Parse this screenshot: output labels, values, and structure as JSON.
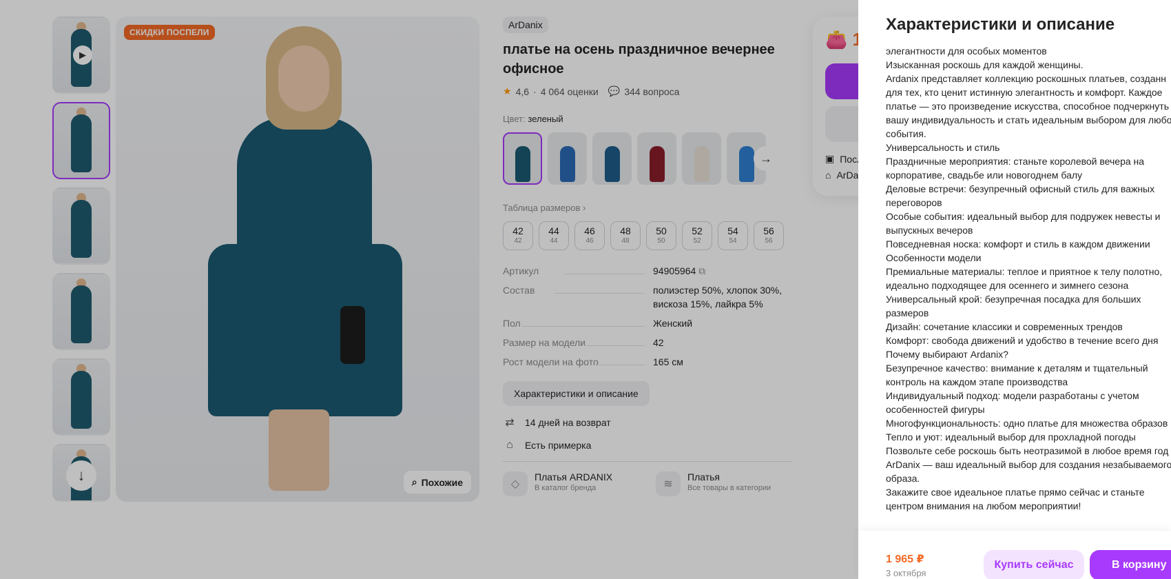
{
  "gallery": {
    "sale_badge": "СКИДКИ ПОСПЕЛИ",
    "similar_label": "Похожие"
  },
  "product": {
    "brand": "ArDanix",
    "title": "платье на осень праздничное вечернее офисное",
    "rating": "4,6",
    "ratings_count": "4 064 оценки",
    "questions": "344 вопроса",
    "color_label": "Цвет:",
    "color_value": "зеленый",
    "size_table_link": "Таблица размеров",
    "sizes": [
      {
        "ru": "42",
        "orig": "42"
      },
      {
        "ru": "44",
        "orig": "44"
      },
      {
        "ru": "46",
        "orig": "46"
      },
      {
        "ru": "48",
        "orig": "48"
      },
      {
        "ru": "50",
        "orig": "50"
      },
      {
        "ru": "52",
        "orig": "52"
      },
      {
        "ru": "54",
        "orig": "54"
      },
      {
        "ru": "56",
        "orig": "56"
      }
    ],
    "specs": [
      {
        "k": "Артикул",
        "v": "94905964"
      },
      {
        "k": "Состав",
        "v": "полиэстер 50%, хлопок 30%, вискоза 15%, лайкра 5%"
      },
      {
        "k": "Пол",
        "v": "Женский"
      },
      {
        "k": "Размер на модели",
        "v": "42"
      },
      {
        "k": "Рост модели на фото",
        "v": "165 см"
      }
    ],
    "char_button": "Характеристики и описание",
    "perks": [
      "14 дней на возврат",
      "Есть примерка"
    ],
    "cats": [
      {
        "title": "Платья ARDANIX",
        "sub": "В каталог бренда"
      },
      {
        "title": "Платья",
        "sub": "Все товары в категории"
      }
    ]
  },
  "buy_card": {
    "price_partial": "1",
    "line1": "Посл",
    "line2": "ArDa"
  },
  "drawer": {
    "title": "Характеристики и описание",
    "lines": [
      "элегантности для особых моментов",
      "Изысканная роскошь для каждой женщины.",
      "Ardanix представляет коллекцию роскошных платьев, созданн",
      "для тех, кто ценит истинную элегантность и комфорт. Каждое",
      "платье — это произведение искусства, способное подчеркнуть",
      "вашу индивидуальность и стать идеальным выбором для любо",
      "события.",
      "Универсальность и стиль",
      "Праздничные мероприятия: станьте королевой вечера на",
      "корпоративе, свадьбе или новогоднем балу",
      "Деловые встречи: безупречный офисный стиль для важных",
      "переговоров",
      "Особые события: идеальный выбор для подружек невесты и",
      "выпускных вечеров",
      "Повседневная носка: комфорт и стиль в каждом движении",
      "Особенности модели",
      "Премиальные материалы: теплое и приятное к телу полотно,",
      "идеально подходящее для осеннего и зимнего сезона",
      "Универсальный крой: безупречная посадка для больших",
      "размеров",
      "Дизайн: сочетание классики и современных трендов",
      "Комфорт: свобода движений и удобство в течение всего дня",
      "Почему выбирают Ardanix?",
      "Безупречное качество: внимание к деталям и тщательный",
      "контроль на каждом этапе производства",
      "Индивидуальный подход: модели разработаны с учетом",
      "особенностей фигуры",
      "Многофункциональность: одно платье для множества образов",
      "Тепло и уют: идеальный выбор для прохладной погоды",
      "Позвольте себе роскошь быть неотразимой в любое время год",
      "ArDanix — ваш идеальный выбор для создания незабываемого",
      "образа.",
      "Закажите свое идеальное платье прямо сейчас и станьте",
      "центром внимания на любом мероприятии!"
    ],
    "footer": {
      "price": "1 965 ₽",
      "date": "3 октября",
      "buy_now": "Купить сейчас",
      "to_cart": "В корзину"
    }
  },
  "colors": {
    "accent": "#a73afd",
    "price": "#f36a26",
    "dress": "#1a5a70"
  }
}
